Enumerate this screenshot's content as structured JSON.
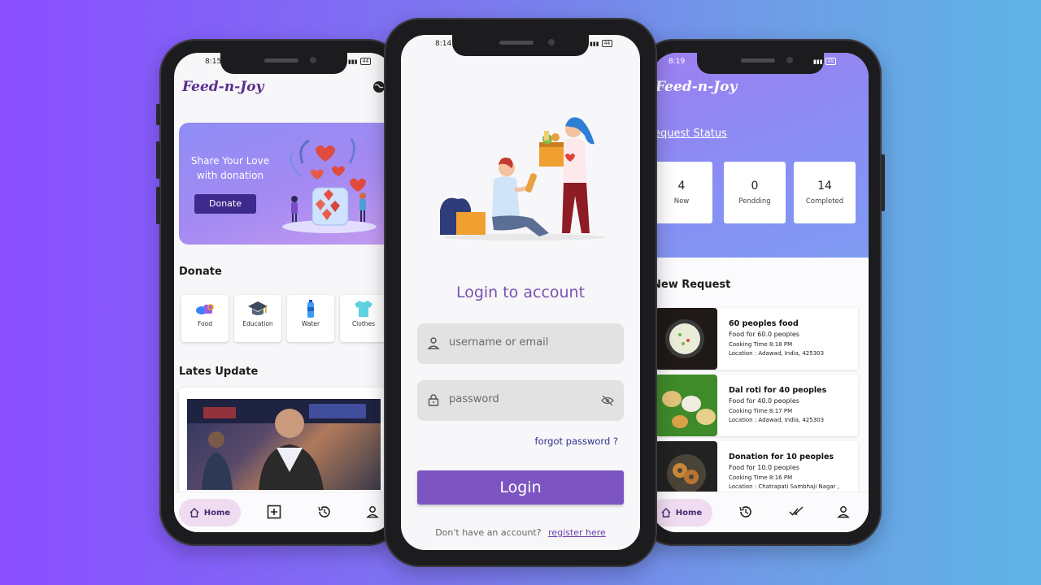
{
  "left_phone": {
    "status_time": "8:15",
    "battery": "44",
    "brand": "Feed-n-Joy",
    "banner": {
      "text": "Share Your Love with donation",
      "button": "Donate"
    },
    "donate_title": "Donate",
    "categories": [
      {
        "label": "Food",
        "icon": "food-icon"
      },
      {
        "label": "Education",
        "icon": "graduation-cap-icon"
      },
      {
        "label": "Water",
        "icon": "water-bottle-icon"
      },
      {
        "label": "Clothes",
        "icon": "tshirt-icon"
      }
    ],
    "updates_title": "Lates Update",
    "nav": {
      "home": "Home"
    }
  },
  "middle_phone": {
    "status_time": "8:14",
    "battery": "44",
    "title": "Login to account",
    "username_placeholder": "username or email",
    "password_placeholder": "password",
    "forgot": "forgot password ?",
    "login_button": "Login",
    "signup_prompt": "Don't have an account?",
    "signup_link": "register here"
  },
  "right_phone": {
    "status_time": "8:19",
    "battery": "45",
    "brand": "Feed-n-Joy",
    "status_title": "equest Status",
    "stats": [
      {
        "value": "4",
        "label": "New"
      },
      {
        "value": "0",
        "label": "Pendding"
      },
      {
        "value": "14",
        "label": "Completed"
      }
    ],
    "new_request_title": "New Request",
    "requests": [
      {
        "title": "60 peoples food",
        "line1": "Food for 60.0 peoples",
        "line2": "Cooking Time 8:18 PM",
        "line3": "Location : Adawad, India, 425303"
      },
      {
        "title": "Dal roti for 40 peoples",
        "line1": "Food for 40.0 peoples",
        "line2": "Cooking Time 8:17 PM",
        "line3": "Location : Adawad, India, 425303"
      },
      {
        "title": "Donation for 10 peoples",
        "line1": "Food for 10.0 peoples",
        "line2": "Cooking Time 8:16 PM",
        "line3": "Location : Chatrapati Sambhaji Nagar ,"
      }
    ],
    "nav": {
      "home": "Home"
    }
  },
  "colors": {
    "accent": "#7c55c2",
    "brand": "#5a2f8f",
    "banner_button": "#3d2a8c"
  }
}
